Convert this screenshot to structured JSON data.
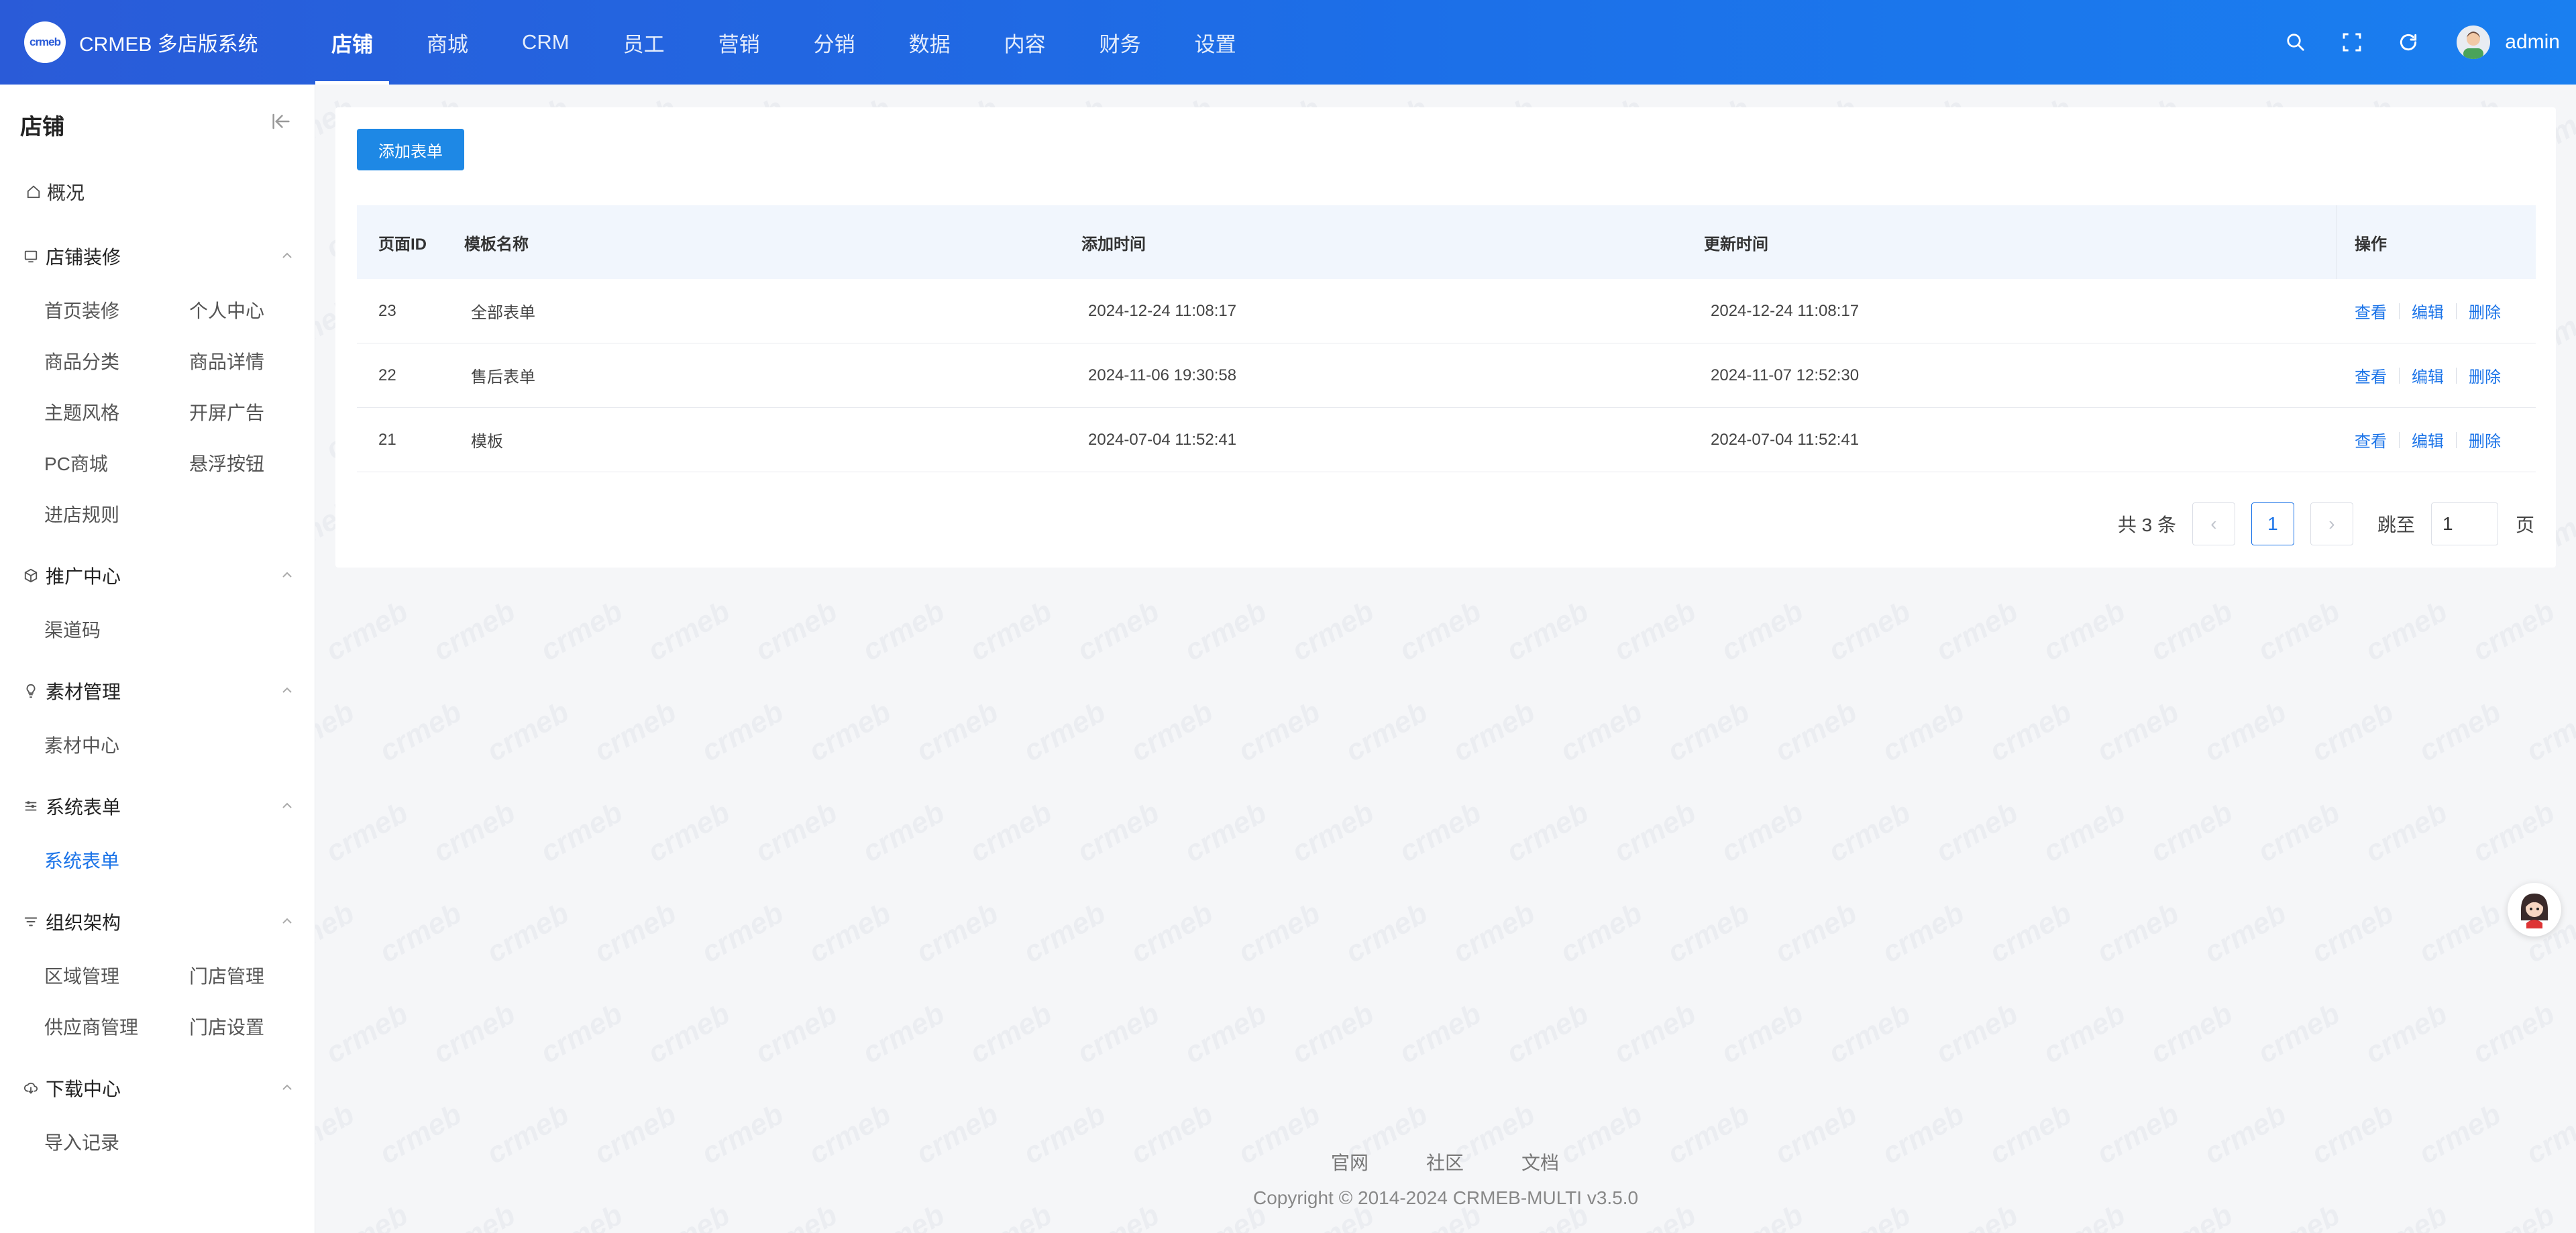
{
  "brand": {
    "logo_text": "crmeb",
    "title": "CRMEB 多店版系统"
  },
  "topnav": [
    {
      "label": "店铺",
      "active": true
    },
    {
      "label": "商城"
    },
    {
      "label": "CRM"
    },
    {
      "label": "员工"
    },
    {
      "label": "营销"
    },
    {
      "label": "分销"
    },
    {
      "label": "数据"
    },
    {
      "label": "内容"
    },
    {
      "label": "财务"
    },
    {
      "label": "设置"
    }
  ],
  "header": {
    "icons": [
      "search-icon",
      "fullscreen-icon",
      "refresh-icon"
    ],
    "user_name": "admin"
  },
  "sidebar": {
    "title": "店铺",
    "overview": "概况",
    "groups": [
      {
        "label": "店铺装修",
        "icon": "monitor-icon",
        "items": [
          "首页装修",
          "个人中心",
          "商品分类",
          "商品详情",
          "主题风格",
          "开屏广告",
          "PC商城",
          "悬浮按钮",
          "进店规则"
        ]
      },
      {
        "label": "推广中心",
        "icon": "cube-icon",
        "items": [
          "渠道码"
        ]
      },
      {
        "label": "素材管理",
        "icon": "bulb-icon",
        "items": [
          "素材中心"
        ]
      },
      {
        "label": "系统表单",
        "icon": "form-icon",
        "items": [
          "系统表单"
        ]
      },
      {
        "label": "组织架构",
        "icon": "filter-icon",
        "items": [
          "区域管理",
          "门店管理",
          "供应商管理",
          "门店设置"
        ]
      },
      {
        "label": "下载中心",
        "icon": "cloud-download-icon",
        "items": [
          "导入记录"
        ]
      }
    ],
    "active_item": "系统表单"
  },
  "main": {
    "add_button": "添加表单",
    "columns": [
      "页面ID",
      "模板名称",
      "添加时间",
      "更新时间",
      "操作"
    ],
    "rows": [
      {
        "id": "23",
        "name": "全部表单",
        "added": "2024-12-24 11:08:17",
        "updated": "2024-12-24 11:08:17"
      },
      {
        "id": "22",
        "name": "售后表单",
        "added": "2024-11-06 19:30:58",
        "updated": "2024-11-07 12:52:30"
      },
      {
        "id": "21",
        "name": "模板",
        "added": "2024-07-04 11:52:41",
        "updated": "2024-07-04 11:52:41"
      }
    ],
    "actions": [
      "查看",
      "编辑",
      "删除"
    ],
    "pagination": {
      "total": "共 3 条",
      "prev": "‹",
      "current": "1",
      "next": "›",
      "jump_label": "跳至",
      "jump_value": "1",
      "unit": "页"
    }
  },
  "footer": {
    "links": [
      "官网",
      "社区",
      "文档"
    ],
    "copyright": "Copyright © 2014-2024 CRMEB-MULTI v3.5.0"
  },
  "colors": {
    "header_start": "#2a5bd8",
    "header_end": "#1a7ff0",
    "accent": "#1a73e8",
    "button": "#1e88e5",
    "table_head_bg": "#f1f6fd",
    "page_bg": "#f5f6f8"
  },
  "watermark": "crmeb"
}
